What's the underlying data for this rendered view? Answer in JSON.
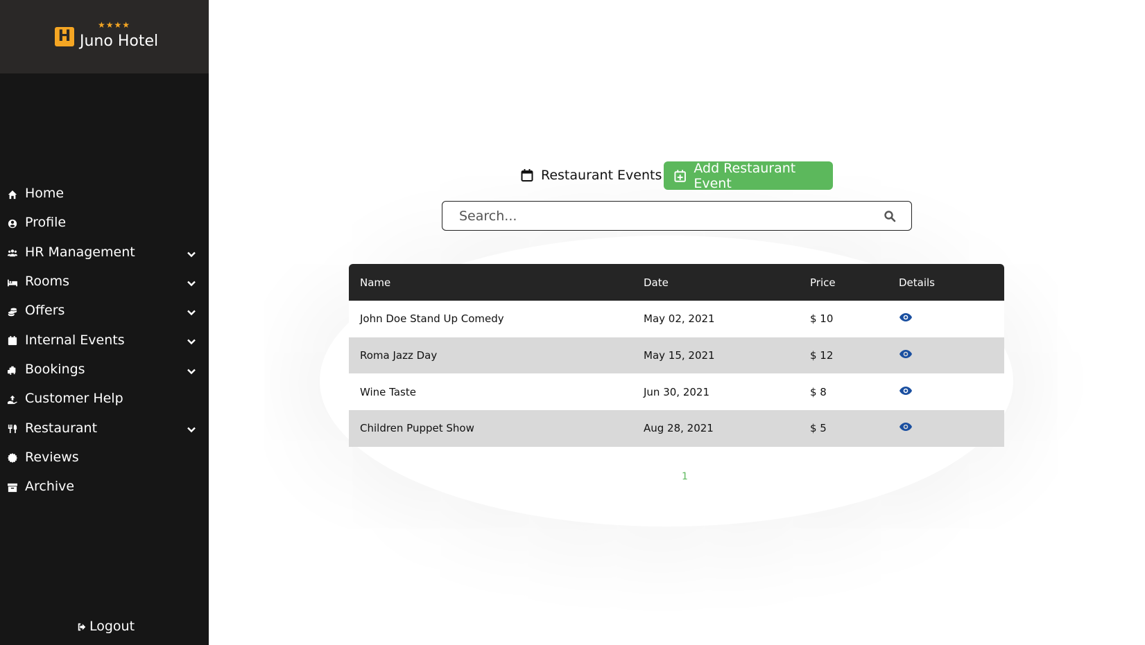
{
  "brand": {
    "name": "Juno Hotel",
    "logo_letter": "H",
    "stars": "★★★★",
    "accent": "#f5a623"
  },
  "sidebar": {
    "items": [
      {
        "label": "Home",
        "icon": "home-icon",
        "expandable": false
      },
      {
        "label": "Profile",
        "icon": "user-circle-icon",
        "expandable": false
      },
      {
        "label": "HR Management",
        "icon": "users-icon",
        "expandable": true
      },
      {
        "label": "Rooms",
        "icon": "bed-icon",
        "expandable": true
      },
      {
        "label": "Offers",
        "icon": "coins-icon",
        "expandable": true
      },
      {
        "label": "Internal Events",
        "icon": "calendar-icon",
        "expandable": true
      },
      {
        "label": "Bookings",
        "icon": "luggage-icon",
        "expandable": true
      },
      {
        "label": "Customer Help",
        "icon": "hand-holding-icon",
        "expandable": false
      },
      {
        "label": "Restaurant",
        "icon": "utensils-icon",
        "expandable": true
      },
      {
        "label": "Reviews",
        "icon": "certificate-icon",
        "expandable": false
      },
      {
        "label": "Archive",
        "icon": "archive-icon",
        "expandable": false
      }
    ],
    "logout_label": "Logout"
  },
  "main": {
    "title": "Restaurant Events",
    "add_button_label": "Add Restaurant Event",
    "search": {
      "placeholder": "Search...",
      "value": ""
    },
    "table": {
      "columns": [
        "Name",
        "Date",
        "Price",
        "Details"
      ],
      "rows": [
        {
          "name": "John Doe Stand Up Comedy",
          "date": "May 02, 2021",
          "price": "$ 10"
        },
        {
          "name": "Roma Jazz Day",
          "date": "May 15, 2021",
          "price": "$ 12"
        },
        {
          "name": "Wine Taste",
          "date": "Jun 30, 2021",
          "price": "$ 8"
        },
        {
          "name": "Children Puppet Show",
          "date": "Aug 28, 2021",
          "price": "$ 5"
        }
      ]
    },
    "pagination": {
      "current_page": "1"
    }
  },
  "colors": {
    "sidebar_bg": "#161616",
    "header_bg": "#2a2827",
    "add_button": "#5cb85c",
    "eye_icon": "#1a4fa0",
    "table_header": "#252525",
    "row_alt": "#d9d9d9"
  }
}
